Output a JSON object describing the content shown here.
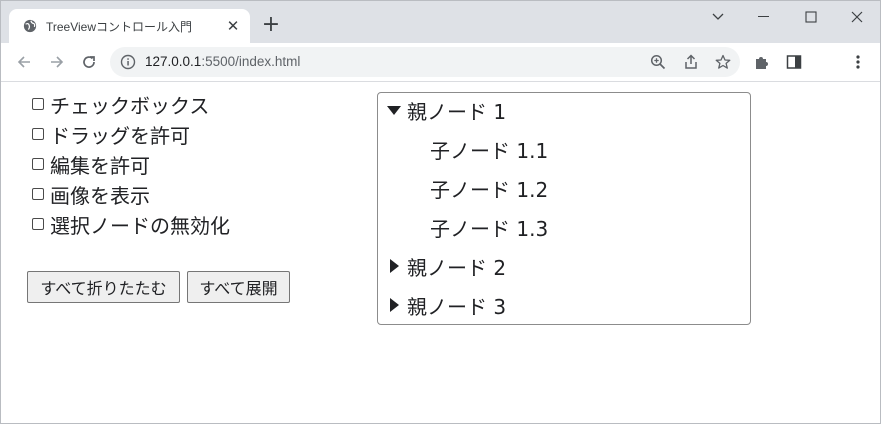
{
  "browser": {
    "tab_title": "TreeViewコントロール入門",
    "tab_close_glyph": "✕",
    "new_tab_glyph": "+",
    "url_host": "127.0.0.1",
    "url_rest": ":5500/index.html"
  },
  "options": [
    {
      "label": "チェックボックス",
      "checked": false
    },
    {
      "label": "ドラッグを許可",
      "checked": false
    },
    {
      "label": "編集を許可",
      "checked": false
    },
    {
      "label": "画像を表示",
      "checked": false
    },
    {
      "label": "選択ノードの無効化",
      "checked": false
    }
  ],
  "buttons": {
    "collapse_all": "すべて折りたたむ",
    "expand_all": "すべて展開"
  },
  "tree": {
    "nodes": [
      {
        "label": "親ノード 1",
        "expanded": true,
        "children": [
          "子ノード 1.1",
          "子ノード 1.2",
          "子ノード 1.3"
        ]
      },
      {
        "label": "親ノード 2",
        "expanded": false
      },
      {
        "label": "親ノード 3",
        "expanded": false
      }
    ]
  },
  "colors": {
    "tabstrip": "#dee1e6",
    "omnibox": "#f1f3f4",
    "button_bg": "#efefef",
    "tree_border": "#8c8c8c"
  }
}
